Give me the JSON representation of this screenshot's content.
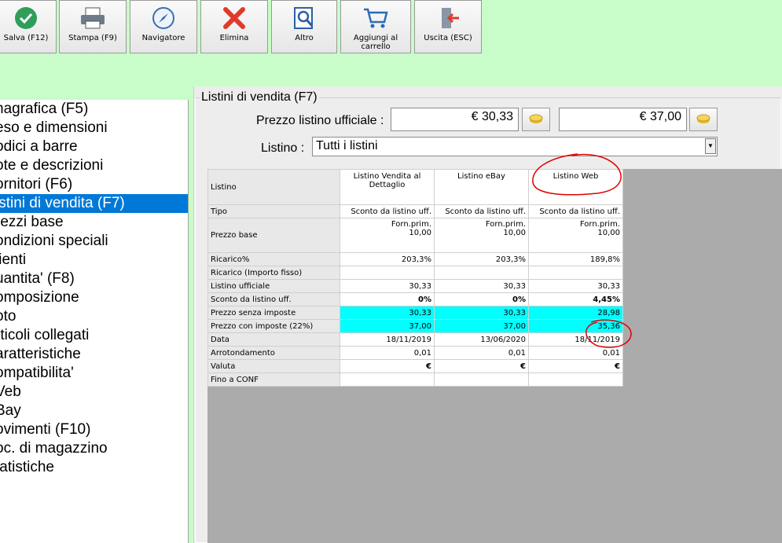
{
  "toolbar": {
    "buttons": [
      {
        "label": "Salva (F12)",
        "icon": "check-icon"
      },
      {
        "label": "Stampa (F9)",
        "icon": "printer-icon"
      },
      {
        "label": "Navigatore",
        "icon": "compass-icon"
      },
      {
        "label": "Elimina",
        "icon": "delete-x-icon"
      },
      {
        "label": "Altro",
        "icon": "search-document-icon"
      },
      {
        "label_line1": "Aggiungi al",
        "label_line2": "carrello",
        "icon": "cart-icon"
      },
      {
        "label": "Uscita (ESC)",
        "icon": "exit-door-icon"
      }
    ]
  },
  "nav": {
    "items": [
      "nagrafica (F5)",
      "eso e dimensioni",
      "odici a barre",
      "ote e descrizioni",
      "ornitori (F6)",
      "istini di vendita (F7)",
      "rezzi base",
      "ondizioni speciali",
      "lienti",
      "uantita' (F8)",
      "omposizione",
      "oto",
      "rticoli collegati",
      "aratteristiche",
      "ompatibilita'",
      "Veb",
      "Bay",
      "ovimenti (F10)",
      "oc. di magazzino",
      "tatistiche"
    ],
    "selected_index": 5
  },
  "panel": {
    "title": "Listini di vendita (F7)",
    "prezzo_label": "Prezzo listino ufficiale :",
    "prezzo_value_1": "€ 30,33",
    "prezzo_value_2": "€ 37,00",
    "listino_label": "Listino :",
    "listino_value": "Tutti i listini"
  },
  "grid": {
    "corner": "Listino",
    "columns": [
      {
        "line1": "Listino Vendita al",
        "line2": "Dettaglio"
      },
      {
        "line1": "Listino eBay",
        "line2": ""
      },
      {
        "line1": "Listino Web",
        "line2": ""
      }
    ],
    "rows": [
      {
        "label": "Tipo",
        "values": [
          "Sconto da listino uff.",
          "Sconto da listino uff.",
          "Sconto da listino uff."
        ]
      },
      {
        "label": "Prezzo base",
        "values": [
          "Forn.prim.",
          "Forn.prim.",
          "Forn.prim."
        ],
        "values2": [
          "10,00",
          "10,00",
          "10,00"
        ]
      },
      {
        "label": "Ricarico%",
        "values": [
          "203,3%",
          "203,3%",
          "189,8%"
        ]
      },
      {
        "label": "Ricarico (Importo fisso)",
        "values": [
          "",
          "",
          ""
        ]
      },
      {
        "label": "Listino ufficiale",
        "values": [
          "30,33",
          "30,33",
          "30,33"
        ]
      },
      {
        "label": "Sconto da listino uff.",
        "values": [
          "0%",
          "0%",
          "4,45%"
        ]
      },
      {
        "label": "Prezzo senza imposte",
        "values": [
          "30,33",
          "30,33",
          "28,98"
        ]
      },
      {
        "label": "Prezzo con imposte (22%)",
        "values": [
          "37,00",
          "37,00",
          "35,36"
        ]
      },
      {
        "label": "Data",
        "values": [
          "18/11/2019",
          "13/06/2020",
          "18/11/2019"
        ]
      },
      {
        "label": "Arrotondamento",
        "values": [
          "0,01",
          "0,01",
          "0,01"
        ]
      },
      {
        "label": "Valuta",
        "values": [
          "€",
          "€",
          "€"
        ]
      },
      {
        "label": "Fino a CONF",
        "values": [
          "",
          "",
          ""
        ]
      }
    ]
  },
  "colors": {
    "background": "#c8fcc8",
    "selection": "#0078d7",
    "highlight": "#00ffff",
    "annotation": "#e00000"
  }
}
